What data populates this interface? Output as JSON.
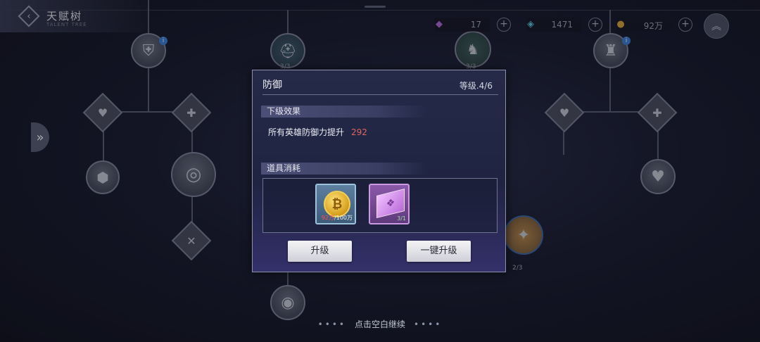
{
  "header": {
    "title": "天赋树",
    "subtitle": "TALENT TREE",
    "back_icon": "chevron-left-icon"
  },
  "resources": [
    {
      "icon": "crystal-icon",
      "value": "17",
      "color": "#b06bd8"
    },
    {
      "icon": "diamond-icon",
      "value": "1471",
      "color": "#5fc7e0"
    },
    {
      "icon": "coin-icon",
      "value": "92万",
      "color": "#d9a53a"
    }
  ],
  "tree_counts": {
    "node_a": "3/3",
    "node_b": "3/3",
    "node_c": "2/3"
  },
  "modal": {
    "title": "防御",
    "level": "等级.4/6",
    "next_effect_header": "下级效果",
    "effect_text": "所有英雄防御力提升",
    "effect_value": "292",
    "cost_header": "道具消耗",
    "items": [
      {
        "name": "gold-coin",
        "count_have": "92万",
        "count_need": "/100万"
      },
      {
        "name": "talent-book",
        "count": "3/1"
      }
    ],
    "upgrade_label": "升级",
    "one_click_label": "一键升级"
  },
  "footer": {
    "continue_text": "点击空白继续",
    "dots": "••••"
  }
}
